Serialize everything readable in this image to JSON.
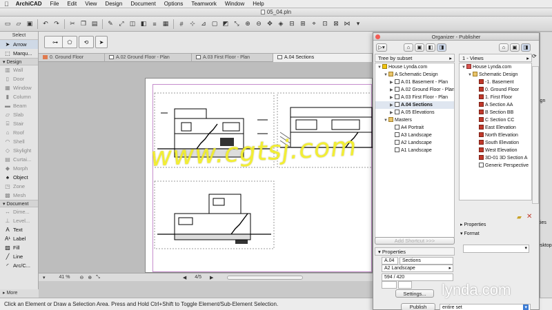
{
  "menubar": {
    "app": "ArchiCAD",
    "items": [
      "File",
      "Edit",
      "View",
      "Design",
      "Document",
      "Options",
      "Teamwork",
      "Window",
      "Help"
    ]
  },
  "window": {
    "title": "05_04.pln"
  },
  "toolbox": {
    "select_label": "Select",
    "tools_top": [
      {
        "label": "Arrow",
        "icon": "arrow-icon",
        "state": "selected"
      },
      {
        "label": "Marqu...",
        "icon": "marquee-icon",
        "state": "active"
      }
    ],
    "design_label": "Design",
    "design_tools": [
      {
        "label": "Wall",
        "icon": "wall-icon"
      },
      {
        "label": "Door",
        "icon": "door-icon"
      },
      {
        "label": "Window",
        "icon": "window-icon"
      },
      {
        "label": "Column",
        "icon": "column-icon"
      },
      {
        "label": "Beam",
        "icon": "beam-icon"
      },
      {
        "label": "Slab",
        "icon": "slab-icon"
      },
      {
        "label": "Stair",
        "icon": "stair-icon"
      },
      {
        "label": "Roof",
        "icon": "roof-icon"
      },
      {
        "label": "Shell",
        "icon": "shell-icon"
      },
      {
        "label": "Skylight",
        "icon": "skylight-icon"
      },
      {
        "label": "Curtai...",
        "icon": "curtain-wall-icon"
      },
      {
        "label": "Morph",
        "icon": "morph-icon"
      },
      {
        "label": "Object",
        "icon": "object-icon",
        "state": "active"
      },
      {
        "label": "Zone",
        "icon": "zone-icon"
      },
      {
        "label": "Mesh",
        "icon": "mesh-icon"
      }
    ],
    "document_label": "Document",
    "document_tools": [
      {
        "label": "Dime...",
        "icon": "dimension-icon"
      },
      {
        "label": "Level...",
        "icon": "level-dimension-icon"
      },
      {
        "label": "Text",
        "icon": "text-icon",
        "state": "active"
      },
      {
        "label": "Label",
        "icon": "label-icon",
        "state": "active"
      },
      {
        "label": "Fill",
        "icon": "fill-icon",
        "state": "active"
      },
      {
        "label": "Line",
        "icon": "line-icon",
        "state": "active"
      },
      {
        "label": "Arc/C...",
        "icon": "arc-icon",
        "state": "active"
      }
    ],
    "more_label": "More"
  },
  "tabs": [
    {
      "label": "0. Ground Floor",
      "active": false
    },
    {
      "label": "A.02 Ground Floor - Plan",
      "active": false
    },
    {
      "label": "A.03 First Floor - Plan",
      "active": false
    },
    {
      "label": "A.04 Sections",
      "active": true
    }
  ],
  "navbar": {
    "zoom": "41 %",
    "page": "4/5"
  },
  "status": {
    "text": "Click an Element or Draw a Selection Area. Press and Hold Ctrl+Shift to Toggle Element/Sub-Element Selection."
  },
  "organizer": {
    "title": "Organizer - Publisher",
    "left_header": "Tree by subset",
    "right_header": "1 - Views",
    "left_tree": [
      {
        "label": "House Lynda.com",
        "depth": 0,
        "icon": "pencil",
        "tri": "▼"
      },
      {
        "label": "A Schematic Design",
        "depth": 1,
        "icon": "folder",
        "tri": "▼"
      },
      {
        "label": "A.01 Basement - Plan",
        "depth": 2,
        "icon": "doc",
        "tri": "▶"
      },
      {
        "label": "A.02 Ground Floor - Plan",
        "depth": 2,
        "icon": "doc",
        "tri": "▶"
      },
      {
        "label": "A.03 First Floor - Plan",
        "depth": 2,
        "icon": "doc",
        "tri": "▶"
      },
      {
        "label": "A.04 Sections",
        "depth": 2,
        "icon": "doc",
        "tri": "▶",
        "bold": true,
        "selected": true
      },
      {
        "label": "A.05 Elevations",
        "depth": 2,
        "icon": "doc",
        "tri": "▶"
      },
      {
        "label": "Masters",
        "depth": 1,
        "icon": "folder",
        "tri": "▼"
      },
      {
        "label": "A4 Portrait",
        "depth": 2,
        "icon": "doc",
        "tri": ""
      },
      {
        "label": "A3 Landscape",
        "depth": 2,
        "icon": "doc",
        "tri": ""
      },
      {
        "label": "A2 Landscape",
        "depth": 2,
        "icon": "doc",
        "tri": ""
      },
      {
        "label": "A1 Landscape",
        "depth": 2,
        "icon": "doc",
        "tri": ""
      }
    ],
    "right_tree": [
      {
        "label": "House Lynda.com",
        "depth": 0,
        "icon": "house",
        "tri": "▼"
      },
      {
        "label": "Schematic Design",
        "depth": 1,
        "icon": "folder",
        "tri": "▼"
      },
      {
        "label": "-1. Basement",
        "depth": 2,
        "icon": "red"
      },
      {
        "label": "0. Ground Floor",
        "depth": 2,
        "icon": "red"
      },
      {
        "label": "1. First Floor",
        "depth": 2,
        "icon": "red"
      },
      {
        "label": "A Section AA",
        "depth": 2,
        "icon": "red"
      },
      {
        "label": "B Section BB",
        "depth": 2,
        "icon": "red"
      },
      {
        "label": "C Section CC",
        "depth": 2,
        "icon": "red"
      },
      {
        "label": "East Elevation",
        "depth": 2,
        "icon": "red"
      },
      {
        "label": "North Elevation",
        "depth": 2,
        "icon": "red"
      },
      {
        "label": "South Elevation",
        "depth": 2,
        "icon": "red"
      },
      {
        "label": "West Elevation",
        "depth": 2,
        "icon": "red"
      },
      {
        "label": "3D-01 3D Section A",
        "depth": 2,
        "icon": "red"
      },
      {
        "label": "Generic Perspective",
        "depth": 2,
        "icon": "doc"
      }
    ],
    "add_shortcut": "Add Shortcut >>>",
    "properties_label": "Properties",
    "props": {
      "id": "A.04",
      "name": "Sections",
      "master": "A2 Landscape",
      "size": "594 / 420"
    },
    "settings_label": "Settings...",
    "right_properties": "Properties",
    "right_format": "Format",
    "publish_label": "Publish",
    "publish_scope": "entire set"
  },
  "right_strip": {
    "label_1": "ign",
    "label_2": "ties",
    "label_3": "esktop"
  },
  "overlay": {
    "watermark": "www.cgtsj.com",
    "brand": "lynda.com"
  }
}
